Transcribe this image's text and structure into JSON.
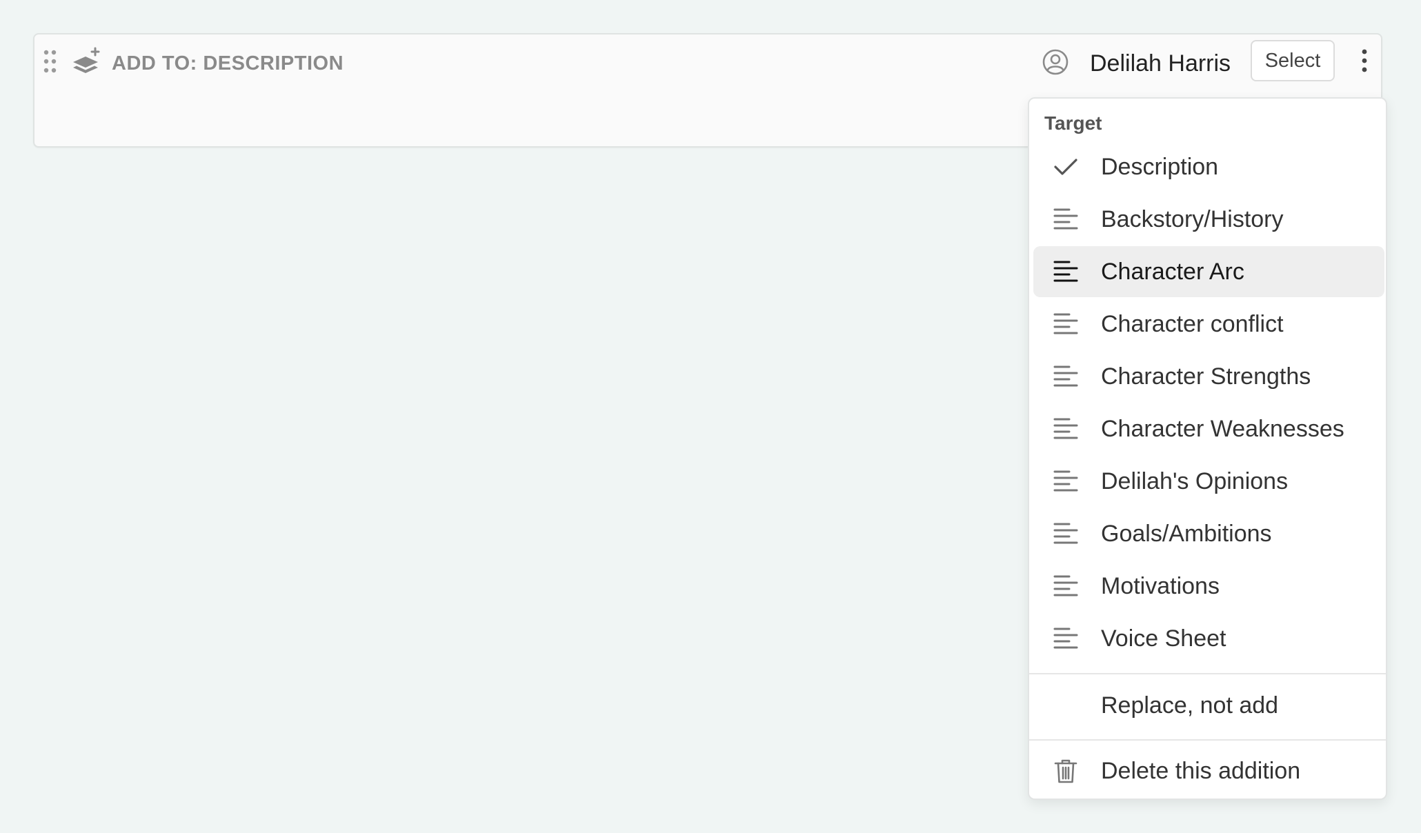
{
  "card": {
    "title": "ADD TO: DESCRIPTION",
    "user_name": "Delilah Harris",
    "select_label": "Select"
  },
  "menu": {
    "header": "Target",
    "items": [
      {
        "label": "Description",
        "icon": "check-icon",
        "selected": true
      },
      {
        "label": "Backstory/History",
        "icon": "text-lines-icon"
      },
      {
        "label": "Character Arc",
        "icon": "text-lines-icon",
        "hovered": true
      },
      {
        "label": "Character conflict",
        "icon": "text-lines-icon"
      },
      {
        "label": "Character Strengths",
        "icon": "text-lines-icon"
      },
      {
        "label": "Character Weaknesses",
        "icon": "text-lines-icon"
      },
      {
        "label": "Delilah's Opinions",
        "icon": "text-lines-icon"
      },
      {
        "label": "Goals/Ambitions",
        "icon": "text-lines-icon"
      },
      {
        "label": "Motivations",
        "icon": "text-lines-icon"
      },
      {
        "label": "Voice Sheet",
        "icon": "text-lines-icon"
      }
    ],
    "replace_label": "Replace, not add",
    "delete_label": "Delete this addition"
  },
  "colors": {
    "background": "#f0f5f4",
    "card": "#fafafa",
    "highlight": "#eeeeee",
    "icon_gray": "#8a8a8a"
  }
}
